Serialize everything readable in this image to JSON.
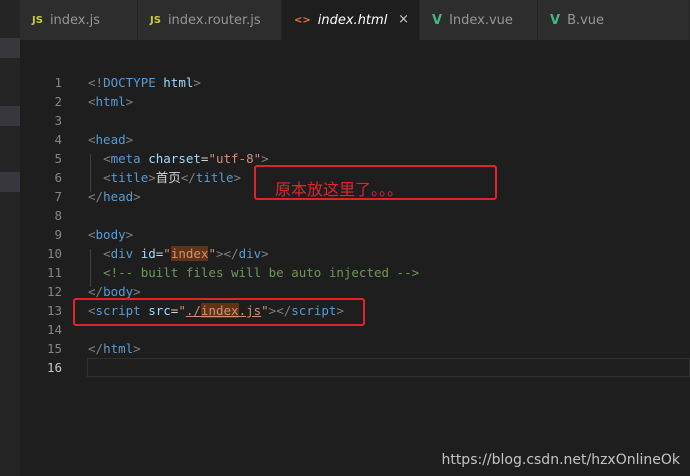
{
  "tabs": [
    {
      "icon": "JS",
      "label": "index.js"
    },
    {
      "icon": "JS",
      "label": "index.router.js"
    },
    {
      "icon": "<>",
      "label": "index.html",
      "close": "×"
    },
    {
      "icon": "V",
      "label": "Index.vue"
    },
    {
      "icon": "V",
      "label": "B.vue"
    }
  ],
  "line_numbers": [
    "1",
    "2",
    "3",
    "4",
    "5",
    "6",
    "7",
    "8",
    "9",
    "10",
    "11",
    "12",
    "13",
    "14",
    "15",
    "16"
  ],
  "current_line": "16",
  "annotation": "原本放这里了。。。",
  "watermark": "https://blog.csdn.net/hzxOnlineOk",
  "code": {
    "l1": {
      "lt": "<!",
      "tag": "DOCTYPE",
      "rest": " html",
      "gt": ">"
    },
    "l2": {
      "lt": "<",
      "tag": "html",
      "gt": ">"
    },
    "l4": {
      "lt": "<",
      "tag": "head",
      "gt": ">"
    },
    "l5": {
      "indent": "  ",
      "lt": "<",
      "tag": "meta",
      "attr": " charset",
      "eq": "=",
      "val": "\"utf-8\"",
      "gt": ">"
    },
    "l6": {
      "indent": "  ",
      "lt": "<",
      "tag": "title",
      "gt": ">",
      "text": "首页",
      "clt": "</",
      "ctag": "title",
      "cgt": ">"
    },
    "l7": {
      "lt": "</",
      "tag": "head",
      "gt": ">"
    },
    "l9": {
      "lt": "<",
      "tag": "body",
      "gt": ">"
    },
    "l10": {
      "indent": "  ",
      "lt": "<",
      "tag": "div",
      "attr": " id",
      "eq": "=",
      "q1": "\"",
      "val": "index",
      "q2": "\"",
      "gt": ">",
      "clt": "</",
      "ctag": "div",
      "cgt": ">"
    },
    "l11": {
      "indent": "  ",
      "comment": "<!-- built files will be auto injected -->"
    },
    "l12": {
      "lt": "</",
      "tag": "body",
      "gt": ">"
    },
    "l13": {
      "lt": "<",
      "tag": "script",
      "attr": " src",
      "eq": "=",
      "q1": "\"",
      "p1": "./",
      "p2": "index",
      "p3": ".js",
      "q2": "\"",
      "gt": ">",
      "clt": "</",
      "ctag": "script",
      "cgt": ">"
    },
    "l15": {
      "lt": "</",
      "tag": "html",
      "gt": ">"
    }
  },
  "colors": {
    "background": "#1e1e1e",
    "tag": "#569cd6",
    "attribute": "#9cdcfe",
    "string": "#ce9178",
    "comment": "#6a9955",
    "annotation_red": "#e0242c"
  }
}
